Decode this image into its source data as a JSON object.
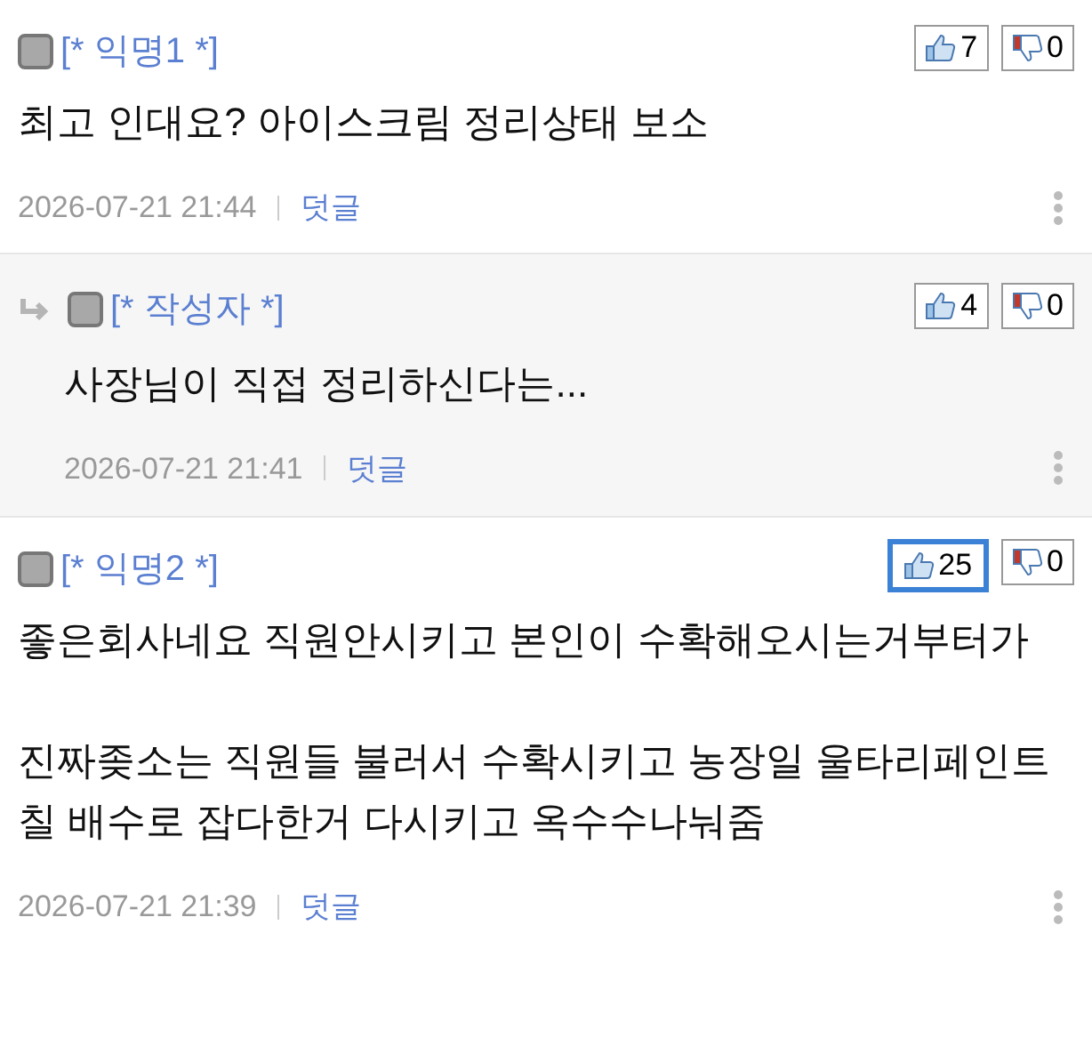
{
  "comments": [
    {
      "kind": "comment",
      "author": "[* 익명1 *]",
      "likes": "7",
      "dislikes": "0",
      "highlighted": false,
      "paragraphs": [
        "최고 인대요? 아이스크림 정리상태 보소"
      ],
      "date": "2026-07-21 21:44",
      "reply_link": "덧글"
    },
    {
      "kind": "reply",
      "author": "[* 작성자 *]",
      "likes": "4",
      "dislikes": "0",
      "highlighted": false,
      "paragraphs": [
        "사장님이 직접 정리하신다는..."
      ],
      "date": "2026-07-21 21:41",
      "reply_link": "덧글"
    },
    {
      "kind": "comment",
      "author": "[* 익명2 *]",
      "likes": "25",
      "dislikes": "0",
      "highlighted": true,
      "paragraphs": [
        "좋은회사네요 직원안시키고 본인이 수확해오시는거부터가",
        "진짜좆소는 직원들 불러서 수확시키고 농장일 울타리페인트칠 배수로 잡다한거 다시키고 옥수수나눠줌"
      ],
      "date": "2026-07-21 21:39",
      "reply_link": "덧글"
    }
  ]
}
